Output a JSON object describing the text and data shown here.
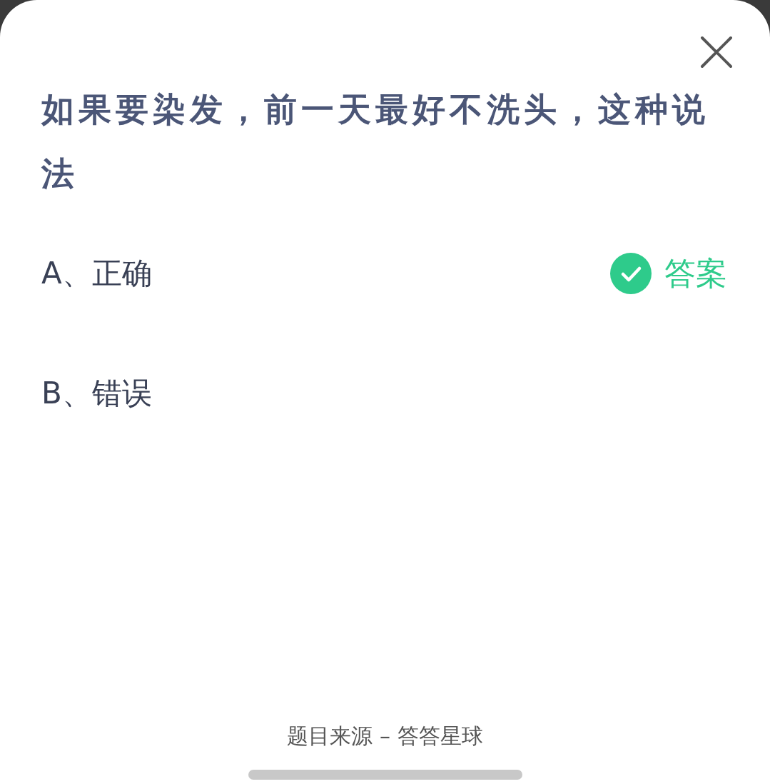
{
  "question": "如果要染发，前一天最好不洗头，这种说法",
  "options": [
    {
      "label": "A、正确",
      "correct": true
    },
    {
      "label": "B、错误",
      "correct": false
    }
  ],
  "answer_badge": "答案",
  "footer": "题目来源 – 答答星球"
}
